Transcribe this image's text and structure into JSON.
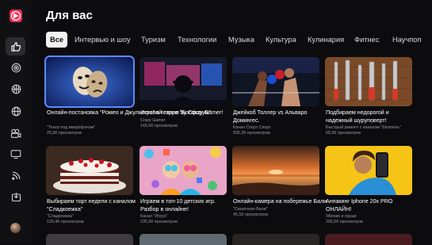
{
  "header": {
    "title": "Для вас"
  },
  "tabs": [
    "Все",
    "Интервью и шоу",
    "Туризм",
    "Технологии",
    "Музыка",
    "Культура",
    "Кулинария",
    "Фитнес",
    "Научпоп"
  ],
  "sidebar": {
    "icons": [
      "thumbs-up-icon",
      "target-icon",
      "basketball-icon",
      "globe-icon",
      "film-camera-icon",
      "tv-icon",
      "broadcast-icon",
      "download-icon"
    ]
  },
  "cards": [
    {
      "title": "Онлайн-постановка \"Ромео и Джульетта\" в театре \"Босфорум\"",
      "channel": "\"Театр под микрофоном\"",
      "views": "25,5К просмотров"
    },
    {
      "title": "Игровой стрим  by Crazy Gamer!",
      "channel": "Crazy Gamer",
      "views": "165,5К просмотров"
    },
    {
      "title": "Джейкоб Толлер vs Альваро Домингес.",
      "channel": "Канал Спорт Спорт",
      "views": "505,2К просмотров"
    },
    {
      "title": "Подбираем недорогой и надежный шуруповерт!",
      "channel": "Быстрый ремонт с каналом \"Шпатель\"",
      "views": "65,5К просмотров"
    },
    {
      "title": "Выбираем торт недели с каналом \"Сладкоежка\"",
      "channel": "\"Сладкоежка\"",
      "views": "125,4К просмотров"
    },
    {
      "title": "Играем в топ-10 детских игр. Разбор в онлайне!",
      "channel": "Канал \"Игрун\"",
      "views": "235,5К просмотров"
    },
    {
      "title": "Онлайн-камера на побережье Бали",
      "channel": "\"Сказочная Бали\"",
      "views": "45,1К просмотров"
    },
    {
      "title": "Анпакинг Iphone 20x PRO ОНЛАЙН!",
      "channel": "Яблоки и груши",
      "views": "265,5К просмотров"
    }
  ],
  "colors": {
    "accent": "#ff2b4f",
    "focus": "#5a8cff",
    "background": "#0c0c0f"
  }
}
